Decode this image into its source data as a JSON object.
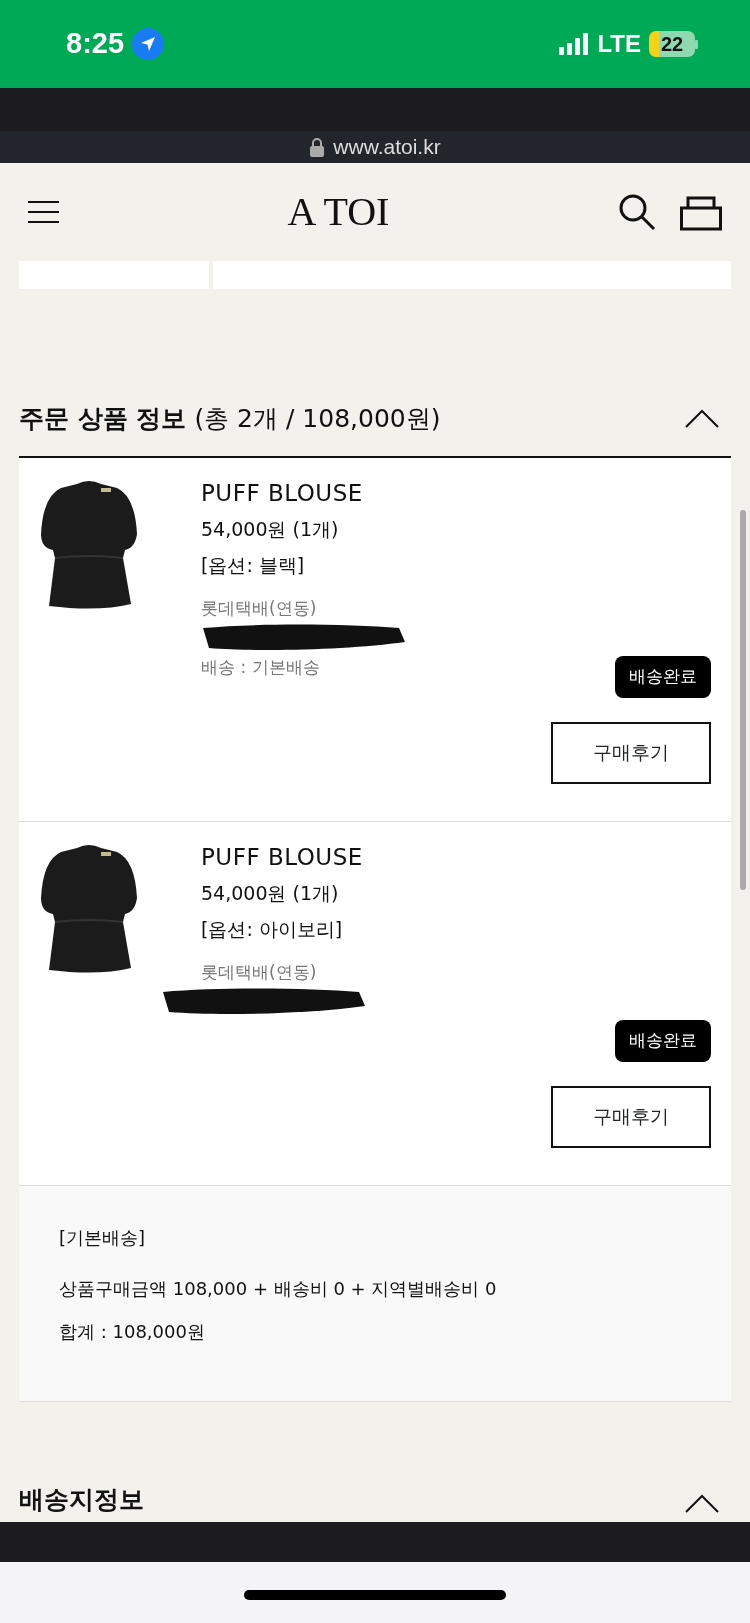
{
  "status_bar": {
    "time": "8:25",
    "network": "LTE",
    "battery": "22"
  },
  "browser": {
    "url": "www.atoi.kr"
  },
  "header": {
    "logo": "A TOI"
  },
  "order_section": {
    "title": "주문 상품 정보",
    "summary": "(총 2개 / 108,000원)",
    "expanded": true,
    "items": [
      {
        "name": "PUFF BLOUSE",
        "price": "54,000원 (1개)",
        "option": "[옵션: 블랙]",
        "carrier": "롯데택배(연동)",
        "shipping": "배송 : 기본배송",
        "status": "배송완료",
        "review_button": "구매후기"
      },
      {
        "name": "PUFF BLOUSE",
        "price": "54,000원 (1개)",
        "option": "[옵션: 아이보리]",
        "carrier": "롯데택배(연동)",
        "status": "배송완료",
        "review_button": "구매후기"
      }
    ],
    "totals": {
      "group": "[기본배송]",
      "breakdown": "상품구매금액 108,000 + 배송비 0 + 지역별배송비 0",
      "total": "합계 : 108,000원"
    }
  },
  "delivery_section": {
    "title": "배송지정보",
    "expanded": true
  }
}
